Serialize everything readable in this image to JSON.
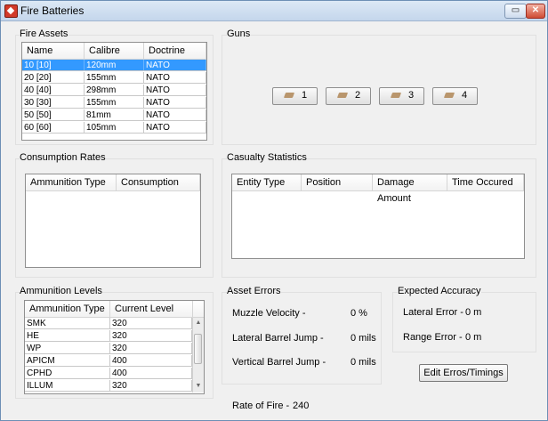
{
  "window": {
    "title": "Fire Batteries",
    "minimize": "▭",
    "close": "✕"
  },
  "fire_assets": {
    "title": "Fire Assets",
    "columns": [
      "Name",
      "Calibre",
      "Doctrine"
    ],
    "rows": [
      [
        "10 [10]",
        "120mm",
        "NATO"
      ],
      [
        "20 [20]",
        "155mm",
        "NATO"
      ],
      [
        "40 [40]",
        "298mm",
        "NATO"
      ],
      [
        "30 [30]",
        "155mm",
        "NATO"
      ],
      [
        "50 [50]",
        "81mm",
        "NATO"
      ],
      [
        "60 [60]",
        "105mm",
        "NATO"
      ]
    ]
  },
  "guns": {
    "title": "Guns",
    "buttons": [
      "1",
      "2",
      "3",
      "4"
    ]
  },
  "consumption": {
    "title": "Consumption Rates",
    "columns": [
      "Ammunition Type",
      "Consumption"
    ]
  },
  "casualty": {
    "title": "Casualty Statistics",
    "columns": [
      "Entity Type",
      "Position",
      "Damage Amount",
      "Time Occured"
    ]
  },
  "ammo_levels": {
    "title": "Ammunition Levels",
    "columns": [
      "Ammunition Type",
      "Current Level"
    ],
    "rows": [
      [
        "SMK",
        "320"
      ],
      [
        "HE",
        "320"
      ],
      [
        "WP",
        "320"
      ],
      [
        "APICM",
        "400"
      ],
      [
        "CPHD",
        "400"
      ],
      [
        "ILLUM",
        "320"
      ]
    ]
  },
  "asset_errors": {
    "title": "Asset Errors",
    "items": [
      {
        "label": "Muzzle Velocity -",
        "value": "0 %"
      },
      {
        "label": "Lateral Barrel Jump -",
        "value": "0 mils"
      },
      {
        "label": "Vertical Barrel Jump -",
        "value": "0 mils"
      }
    ]
  },
  "expected_accuracy": {
    "title": "Expected Accuracy",
    "items": [
      {
        "label": "Lateral Error -",
        "value": "0 m"
      },
      {
        "label": "Range Error -",
        "value": "0 m"
      }
    ],
    "button": "Edit Erros/Timings"
  },
  "rate_of_fire": {
    "label": "Rate of Fire -",
    "value": "240"
  }
}
